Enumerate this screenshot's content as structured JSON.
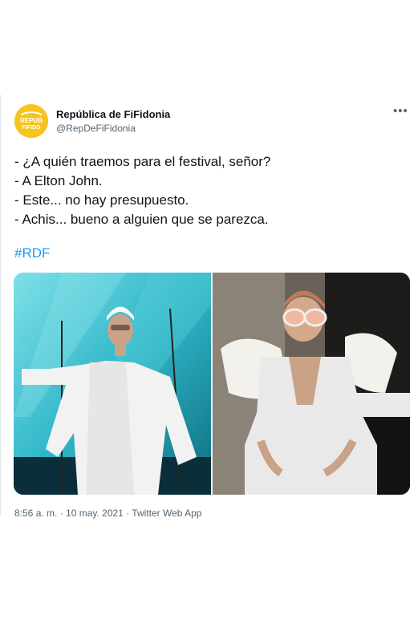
{
  "account": {
    "display_name": "República de FiFidonia",
    "handle": "@RepDeFiFidonia",
    "avatar_icon": "rdf-logo-avatar"
  },
  "tweet": {
    "lines": [
      "- ¿A quién traemos para el festival, señor?",
      "- A Elton John.",
      "- Este... no hay presupuesto.",
      "- Achis... bueno a alguien que se parezca."
    ],
    "hashtag": "#RDF",
    "timestamp": "8:56 a. m. · 10 may. 2021 · Twitter Web App"
  },
  "media": {
    "photos": [
      {
        "icon": "performer-white-outfit-photo"
      },
      {
        "icon": "elton-john-white-suit-photo"
      }
    ]
  },
  "colors": {
    "accent": "#1d9bf0",
    "secondary_text": "#536471",
    "avatar_bg": "#f7c31e"
  }
}
